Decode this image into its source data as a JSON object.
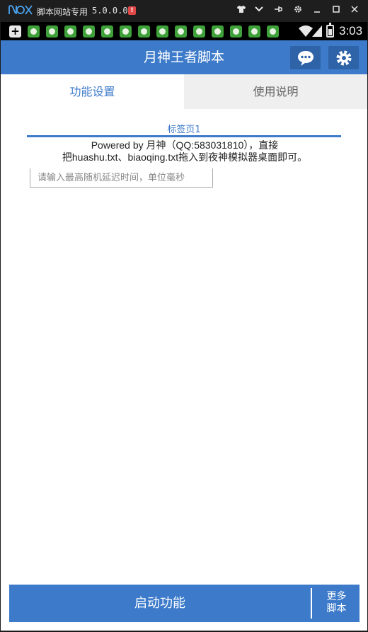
{
  "emulator": {
    "logo": "NOX",
    "title": "脚本网站专用",
    "version": "5.0.0.0",
    "alert": "!"
  },
  "status_bar": {
    "time": "3:03"
  },
  "app": {
    "title": "月神王者脚本",
    "tabs": [
      {
        "label": "功能设置"
      },
      {
        "label": "使用说明"
      }
    ],
    "page_label": "标签页1",
    "info_line1": "Powered by 月神（QQ:583031810），直接",
    "info_line2": "把huashu.txt、biaoqing.txt拖入到夜神模拟器桌面即可。",
    "delay_input": {
      "value": "",
      "placeholder": "请输入最高随机延迟时间，单位毫秒"
    },
    "start_label": "启动功能",
    "more_line1": "更多",
    "more_line2": "脚本"
  },
  "colors": {
    "primary": "#3d7bca",
    "primary_dark": "#2f63a8",
    "emulator_bar": "#1e1e1e",
    "nox_logo": "#4aa3f0",
    "notif_icon": "#3fa13a",
    "inactive_tab": "#efefef"
  }
}
